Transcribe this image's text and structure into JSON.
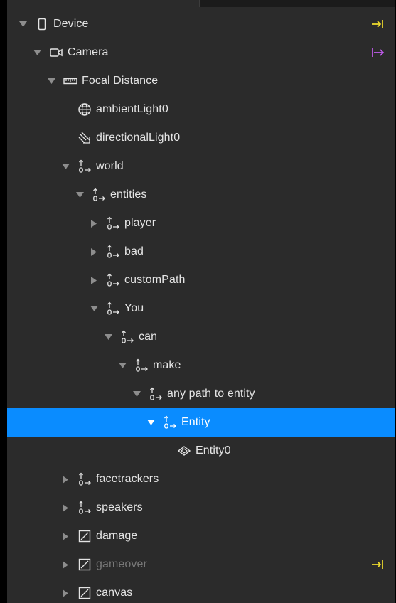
{
  "colors": {
    "panel_bg": "#2b2b2b",
    "text": "#e4e4e4",
    "selection": "#0a8cff",
    "dim_text": "#777777",
    "yellow_accent": "#f0dc2c",
    "purple_accent": "#c45cf0"
  },
  "tree": {
    "rows": [
      {
        "label": "Device",
        "icon": "device-icon",
        "expander": "expanded",
        "end_icon": "yellow-arrow-to-bar-icon"
      },
      {
        "label": "Camera",
        "icon": "camera-icon",
        "expander": "expanded",
        "end_icon": "purple-bar-arrow-icon"
      },
      {
        "label": "Focal Distance",
        "icon": "ruler-icon",
        "expander": "expanded"
      },
      {
        "label": "ambientLight0",
        "icon": "globe-light-icon",
        "expander": "none"
      },
      {
        "label": "directionalLight0",
        "icon": "directional-light-icon",
        "expander": "none"
      },
      {
        "label": "world",
        "icon": "null-object-icon",
        "expander": "expanded"
      },
      {
        "label": "entities",
        "icon": "null-object-icon",
        "expander": "expanded"
      },
      {
        "label": "player",
        "icon": "null-object-icon",
        "expander": "collapsed"
      },
      {
        "label": "bad",
        "icon": "null-object-icon",
        "expander": "collapsed"
      },
      {
        "label": "customPath",
        "icon": "null-object-icon",
        "expander": "collapsed"
      },
      {
        "label": "You",
        "icon": "null-object-icon",
        "expander": "expanded"
      },
      {
        "label": "can",
        "icon": "null-object-icon",
        "expander": "expanded"
      },
      {
        "label": "make",
        "icon": "null-object-icon",
        "expander": "expanded"
      },
      {
        "label": "any path to entity",
        "icon": "null-object-icon",
        "expander": "expanded"
      },
      {
        "label": "Entity",
        "icon": "null-object-icon",
        "expander": "expanded",
        "selected": true
      },
      {
        "label": "Entity0",
        "icon": "diamond-icon",
        "expander": "none"
      },
      {
        "label": "facetrackers",
        "icon": "null-object-icon",
        "expander": "collapsed"
      },
      {
        "label": "speakers",
        "icon": "null-object-icon",
        "expander": "collapsed"
      },
      {
        "label": "damage",
        "icon": "rectangle-icon",
        "expander": "collapsed"
      },
      {
        "label": "gameover",
        "icon": "rectangle-icon",
        "expander": "collapsed",
        "dim": true,
        "end_icon": "yellow-arrow-to-bar-icon"
      },
      {
        "label": "canvas",
        "icon": "rectangle-icon",
        "expander": "collapsed"
      }
    ]
  }
}
